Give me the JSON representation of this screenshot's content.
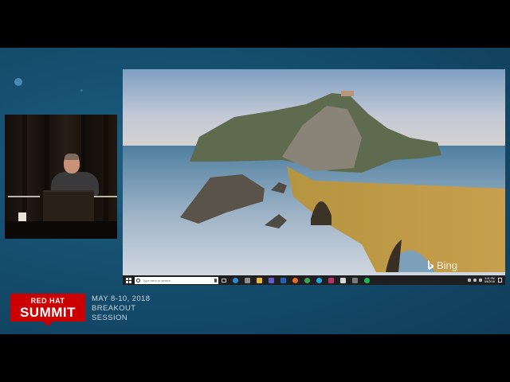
{
  "desktop": {
    "taskbar": {
      "search_placeholder": "Type here to search",
      "clock_time": "3:41 PM",
      "clock_date": "5/8/2018"
    },
    "watermark": "Bing"
  },
  "branding": {
    "logo_line1": "RED HAT",
    "logo_line2": "SUMMIT",
    "event_dates": "MAY 8-10, 2018",
    "event_line2": "BREAKOUT",
    "event_line3": "SESSION"
  }
}
